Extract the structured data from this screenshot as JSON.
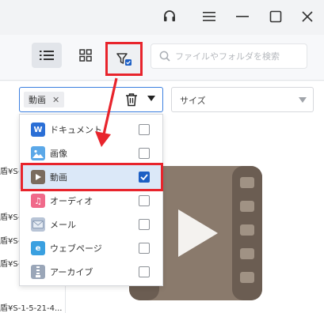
{
  "toolbar": {
    "search_placeholder": "ファイルやフォルダを検索"
  },
  "filters": {
    "type_tag": "動画",
    "size_label": "サイズ"
  },
  "file_types": [
    {
      "label": "ドキュメント",
      "checked": false,
      "icon": "word-doc-icon"
    },
    {
      "label": "画像",
      "checked": false,
      "icon": "image-icon"
    },
    {
      "label": "動画",
      "checked": true,
      "icon": "video-icon"
    },
    {
      "label": "オーディオ",
      "checked": false,
      "icon": "music-icon"
    },
    {
      "label": "メール",
      "checked": false,
      "icon": "mail-icon"
    },
    {
      "label": "ウェブページ",
      "checked": false,
      "icon": "webpage-icon"
    },
    {
      "label": "アーカイブ",
      "checked": false,
      "icon": "archive-icon"
    }
  ],
  "paths": [
    "盾¥S-",
    "盾¥S-",
    "盾¥S-",
    "盾¥S-",
    "盾¥S-1-5-21-4..."
  ],
  "colors": {
    "highlight": "#e8242c",
    "accent": "#1d5fc4",
    "selected_row": "#dbe8f8",
    "video_thumb": "#8a7a6c"
  }
}
